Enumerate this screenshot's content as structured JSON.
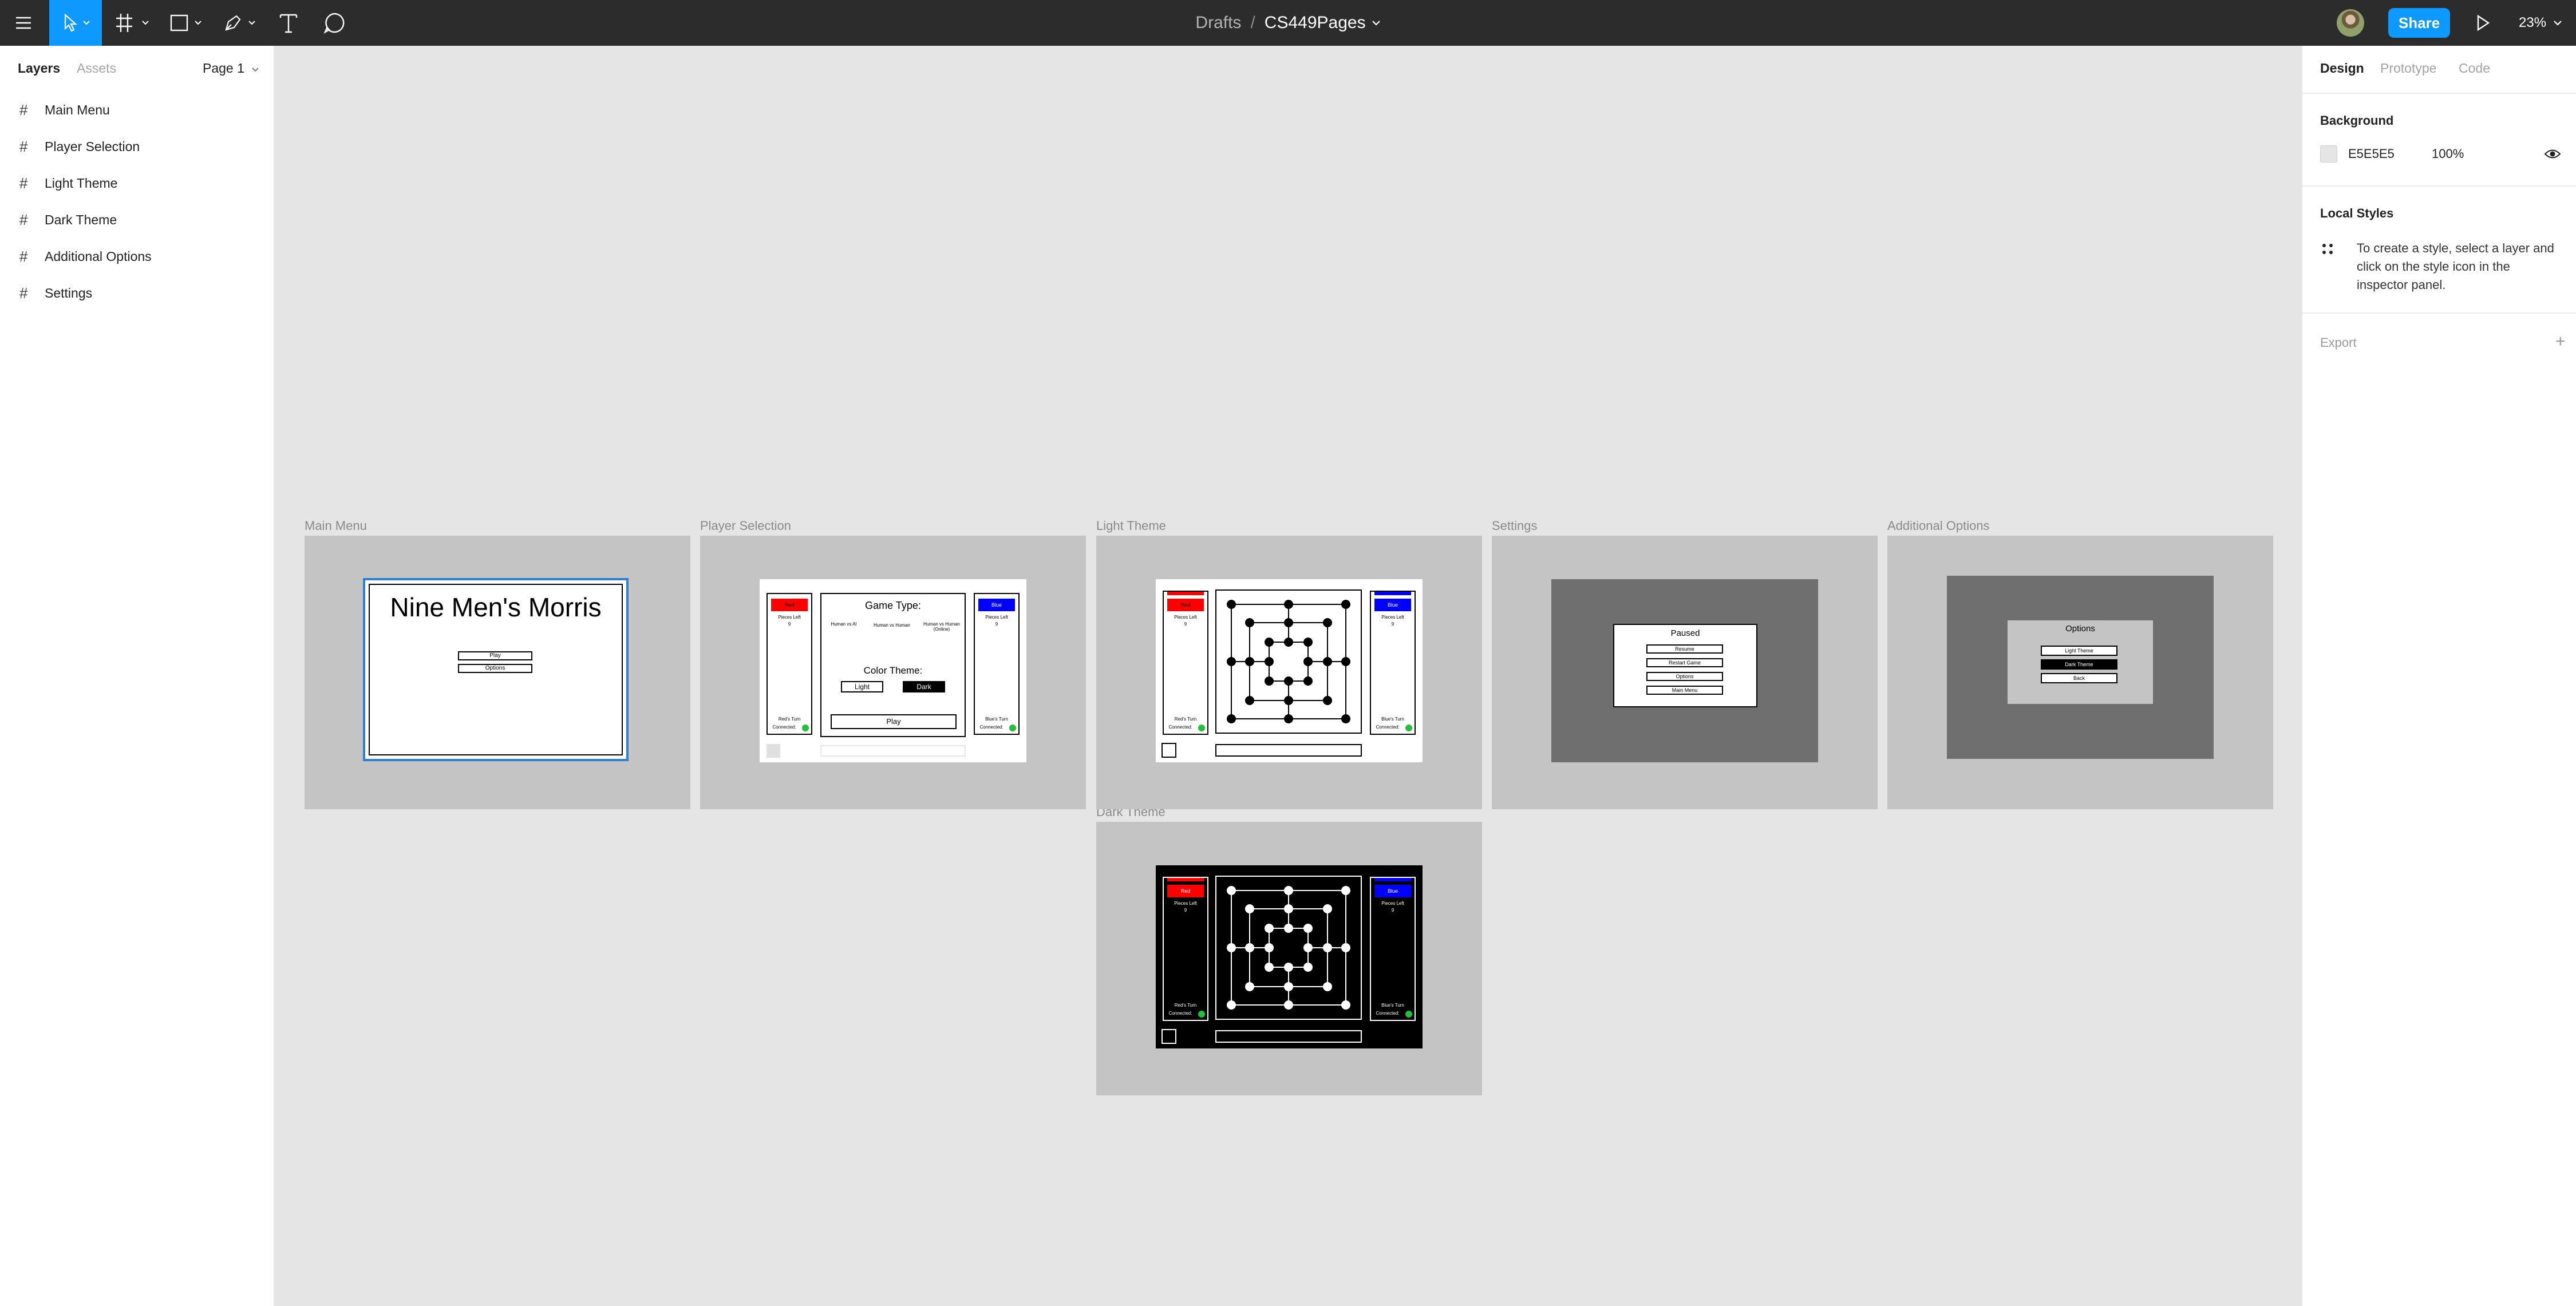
{
  "toolbar": {
    "breadcrumb_parent": "Drafts",
    "breadcrumb_separator": "/",
    "file_name": "CS449Pages",
    "share_label": "Share",
    "zoom_label": "23%",
    "accent_color": "#0d99ff",
    "icons": [
      "main-menu-icon",
      "move-tool-icon",
      "frame-tool-icon",
      "rectangle-tool-icon",
      "pen-tool-icon",
      "text-tool-icon",
      "comment-tool-icon",
      "avatar",
      "present-icon"
    ]
  },
  "left_panel": {
    "tabs": [
      "Layers",
      "Assets"
    ],
    "page_label": "Page 1",
    "layers": [
      "Main Menu",
      "Player Selection",
      "Light Theme",
      "Dark Theme",
      "Additional Options",
      "Settings"
    ]
  },
  "right_panel": {
    "tabs": [
      "Design",
      "Prototype",
      "Code"
    ],
    "background_heading": "Background",
    "background_hex": "E5E5E5",
    "background_opacity": "100%",
    "background_color": "#e5e5e5",
    "local_styles_heading": "Local Styles",
    "local_styles_hint": "To create a style, select a layer and click on the style icon in the inspector panel.",
    "export_label": "Export",
    "export_add": "+"
  },
  "canvas": {
    "frame_labels": {
      "main_menu": "Main Menu",
      "player_selection": "Player Selection",
      "light_theme": "Light Theme",
      "settings": "Settings",
      "additional_options": "Additional Options",
      "dark_theme": "Dark Theme"
    },
    "main_menu": {
      "title": "Nine Men's Morris",
      "buttons": [
        "Play",
        "Options"
      ]
    },
    "player_selection": {
      "red_label": "Red",
      "blue_label": "Blue",
      "pieces_left": "Pieces Left",
      "pieces_count": "9",
      "game_type_heading": "Game Type:",
      "game_types": [
        "Human vs AI",
        "Human vs Human",
        "Human vs Human (Online)"
      ],
      "color_theme_heading": "Color Theme:",
      "themes": [
        "Light",
        "Dark"
      ],
      "play_label": "Play",
      "red_turn": "Red's Turn",
      "blue_turn": "Blue's Turn",
      "connected": "Connected:"
    },
    "light_theme": {
      "red_label": "Red",
      "blue_label": "Blue",
      "pieces_left": "Pieces Left",
      "pieces_count": "9",
      "red_turn": "Red's Turn",
      "blue_turn": "Blue's Turn",
      "connected": "Connected:"
    },
    "dark_theme": {
      "red_label": "Red",
      "blue_label": "Blue",
      "pieces_left": "Pieces Left",
      "pieces_count": "9",
      "red_turn": "Red's Turn",
      "blue_turn": "Blue's Turn",
      "connected": "Connected:"
    },
    "settings": {
      "title": "Paused",
      "buttons": [
        "Resume",
        "Restart Game",
        "Options",
        "Main Menu"
      ]
    },
    "additional_options": {
      "title": "Options",
      "buttons": [
        "Light Theme",
        "Dark Theme",
        "Back"
      ]
    },
    "colors": {
      "red": "#ff0000",
      "blue": "#0000ff",
      "connected_green": "#22c03a",
      "selection_blue": "#2f80d1",
      "frame_gray": "#c4c4c4",
      "overlay_gray": "#6f6f6f"
    }
  }
}
